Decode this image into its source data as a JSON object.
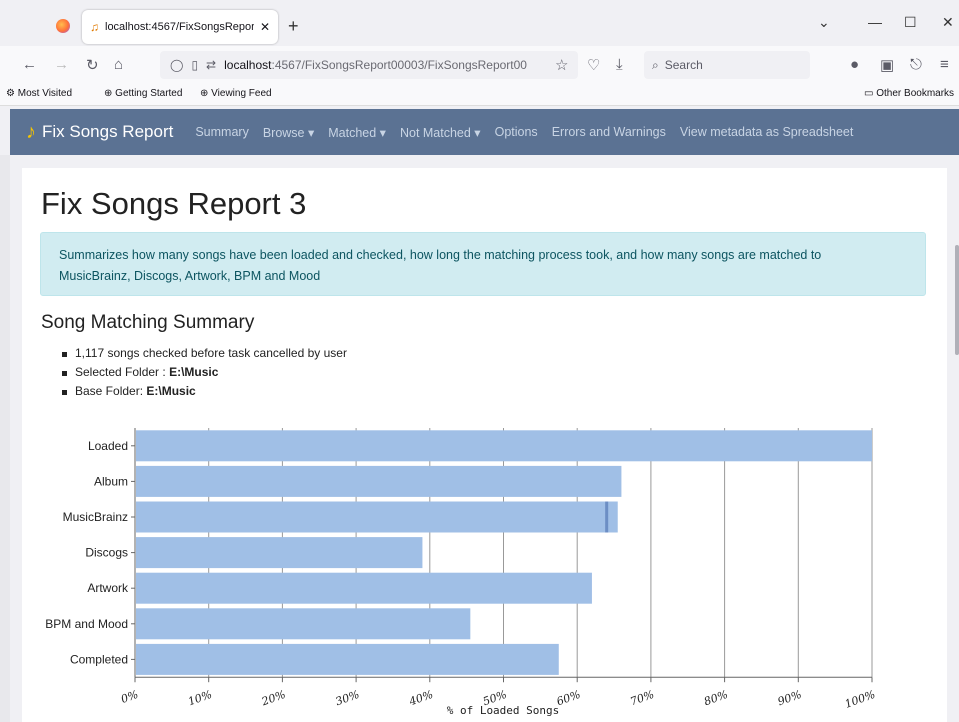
{
  "browser": {
    "tab_title": "localhost:4567/FixSongsReport0",
    "url_host": "localhost",
    "url_path": ":4567/FixSongsReport00003/FixSongsReport00",
    "search_placeholder": "Search",
    "bookmarks": [
      "Most Visited",
      "Getting Started",
      "Viewing Feed"
    ],
    "other_bookmarks": "Other Bookmarks"
  },
  "app": {
    "brand": "Fix Songs Report",
    "nav": [
      "Summary",
      "Browse ▾",
      "Matched ▾",
      "Not Matched ▾",
      "Options",
      "Errors and Warnings",
      "View metadata as Spreadsheet"
    ]
  },
  "page": {
    "title": "Fix Songs Report 3",
    "alert_line1": "Summarizes how many songs have been loaded and checked, how long the matching process took, and how many songs are matched to",
    "alert_line2": "MusicBrainz, Discogs, Artwork, BPM and Mood",
    "section_title": "Song Matching Summary",
    "bullet1": "1,117 songs checked before task cancelled by user",
    "bullet2_label": "Selected Folder : ",
    "bullet2_value": "E:\\Music",
    "bullet3_label": "Base Folder: ",
    "bullet3_value": "E:\\Music"
  },
  "colors": {
    "bar": "#a0bfe6",
    "bar_dark": "#6c8ec4",
    "navbar": "#5b7293",
    "alert_bg": "#d1ecf1"
  },
  "chart_data": {
    "type": "bar",
    "orientation": "horizontal",
    "categories": [
      "Loaded",
      "Album",
      "MusicBrainz",
      "Discogs",
      "Artwork",
      "BPM and Mood",
      "Completed"
    ],
    "values": [
      100,
      66,
      65.5,
      39,
      62,
      45.5,
      57.5
    ],
    "marker": {
      "category": "MusicBrainz",
      "value": 64
    },
    "xlabel": "% of Loaded Songs",
    "xticks": [
      "0%",
      "10%",
      "20%",
      "30%",
      "40%",
      "50%",
      "60%",
      "70%",
      "80%",
      "90%",
      "100%"
    ],
    "xlim": [
      0,
      100
    ],
    "grid": true
  }
}
